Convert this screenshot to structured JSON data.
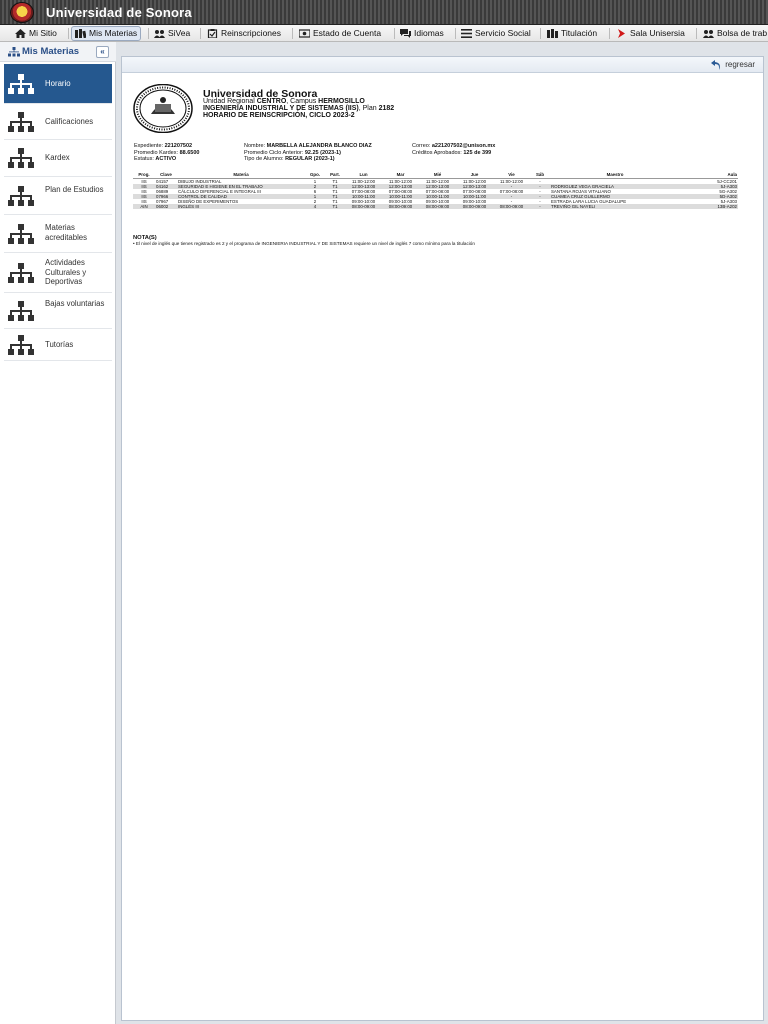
{
  "window": {
    "title": "Universidad de Sonora"
  },
  "menu": {
    "items": [
      {
        "label": "Mi Sitio",
        "icon": "home-icon"
      },
      {
        "label": "Mis Materias",
        "icon": "books-icon",
        "active": true
      },
      {
        "label": "SiVea",
        "icon": "users-icon"
      },
      {
        "label": "Reinscripciones",
        "icon": "clipboard-icon"
      },
      {
        "label": "Estado de Cuenta",
        "icon": "money-icon"
      },
      {
        "label": "Idiomas",
        "icon": "chat-icon"
      },
      {
        "label": "Servicio Social",
        "icon": "list-icon"
      },
      {
        "label": "Titulación",
        "icon": "books-icon"
      },
      {
        "label": "Sala Unisersia",
        "icon": "arrow-icon"
      },
      {
        "label": "Bolsa de trab",
        "icon": "users-icon"
      }
    ]
  },
  "sidebar": {
    "title": "Mis Materias",
    "collapse_label": "«",
    "items": [
      {
        "label": "Horario",
        "active": true
      },
      {
        "label": "Calificaciones"
      },
      {
        "label": "Kardex"
      },
      {
        "label": "Plan de Estudios"
      },
      {
        "label": "Materias acreditables"
      },
      {
        "label": "Actividades Culturales y Deportivas"
      },
      {
        "label": "Bajas voluntarias"
      },
      {
        "label": "Tutorías"
      }
    ]
  },
  "toolbar": {
    "back_label": "regresar"
  },
  "header": {
    "university": "Universidad de Sonora",
    "unit_prefix": "Unidad Regional ",
    "unit_name": "CENTRO",
    "campus_prefix": ", Campus ",
    "campus_name": "HERMOSILLO",
    "program": "INGENIERIA INDUSTRIAL Y DE SISTEMAS (IIS)",
    "plan_prefix": ", Plan ",
    "plan": "2182",
    "schedule_title": "HORARIO DE REINSCRIPCIÓN, CICLO 2023-2"
  },
  "student": {
    "expediente_label": "Expediente: ",
    "expediente": "221207502",
    "kardex_label": "Promedio Kardex: ",
    "kardex": "88.6500",
    "estatus_label": "Estatus: ",
    "estatus": "ACTIVO",
    "nombre_label": "Nombre: ",
    "nombre": "MARBELLA ALEJANDRA BLANCO DIAZ",
    "ciclo_label": "Promedio Ciclo Anterior: ",
    "ciclo": "92.25 (2023-1)",
    "tipo_label": "Tipo de Alumno: ",
    "tipo": "REGULAR (2023-1)",
    "correo_label": "Correo: ",
    "correo": "a221207502@unison.mx",
    "creditos_label": "Créditos Aprobados: ",
    "creditos": "125 de 399"
  },
  "schedule": {
    "columns": [
      "Prog.",
      "Clave",
      "Materia",
      "Gpo.",
      "Part.",
      "Lun",
      "Mar",
      "Mié",
      "Jue",
      "Vie",
      "Sáb",
      "Maestro",
      "Aula"
    ],
    "rows": [
      [
        "IIS",
        "04157",
        "DIBUJO INDUSTRIAL",
        "1",
        "T1",
        "11:00-12:00",
        "11:00-12:00",
        "11:00-12:00",
        "11:00-12:00",
        "11:00-12:00",
        "-",
        "",
        "5J-CC201"
      ],
      [
        "IIS",
        "04162",
        "SEGURIDAD E HIGIENE EN EL TRABAJO",
        "2",
        "T1",
        "12:00-13:00",
        "12:00-13:00",
        "12:00-13:00",
        "12:00-13:00",
        "-",
        "-",
        "RODRIGUEZ VEGA GRACIELA",
        "5J-A303"
      ],
      [
        "IIS",
        "06889",
        "CÁLCULO DIFERENCIAL E INTEGRAL III",
        "6",
        "T1",
        "07:00-08:00",
        "07:00-08:00",
        "07:00-08:00",
        "07:00-08:00",
        "07:00-08:00",
        "-",
        "SANTANA ROJAS VITALIANO",
        "5G-A302"
      ],
      [
        "IIS",
        "07966",
        "CONTROL DE CALIDAD",
        "1",
        "T1",
        "10:00-11:00",
        "10:00-11:00",
        "10:00-11:00",
        "10:00-11:00",
        "-",
        "-",
        "CUAMEA CRUZ GUILLERMO",
        "5D-A302"
      ],
      [
        "IIS",
        "07967",
        "DISEÑO DE EXPERIMENTOS",
        "2",
        "T1",
        "09:00-10:00",
        "09:00-10:00",
        "09:00-10:00",
        "09:00-10:00",
        "-",
        "-",
        "ESTRADA LARA LUCIA GUADALUPE",
        "5J-A303"
      ],
      [
        "AIN",
        "06002",
        "INGLÉS III",
        "4",
        "T1",
        "08:00-09:00",
        "08:00-09:00",
        "08:00-09:00",
        "08:00-09:00",
        "08:00-09:00",
        "-",
        "TREVIÑO GIL NAYELI",
        "13B-A202"
      ]
    ]
  },
  "nota": {
    "title": "NOTA(S)",
    "text": "•  El nivel de inglés que tienes registrado es 2 y el programa de INGENIERIA INDUSTRIAL Y DE SISTEMAS requiere un nivel de inglés 7 como mínimo para la titulación"
  },
  "colors": {
    "accent": "#25588f",
    "title_bar": "#444444",
    "row_alt": "#dcdcdc"
  }
}
